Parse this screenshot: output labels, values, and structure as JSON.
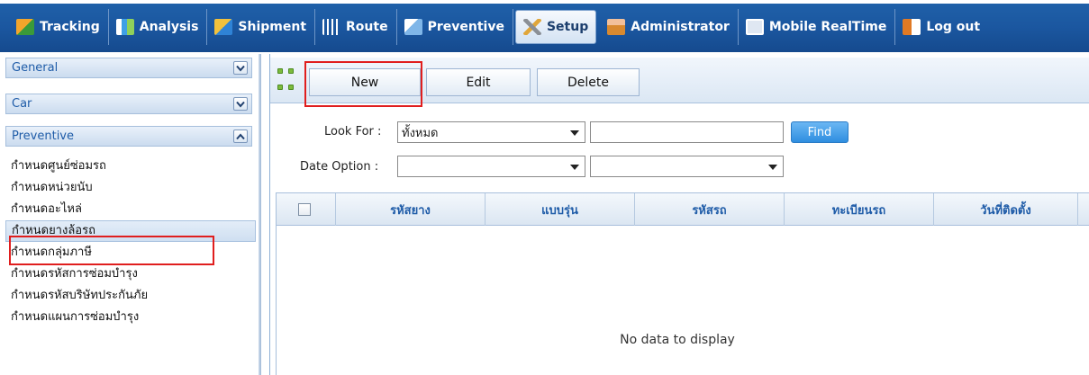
{
  "nav": {
    "items": [
      {
        "label": "Tracking",
        "icon": "tracking-icon"
      },
      {
        "label": "Analysis",
        "icon": "analysis-icon"
      },
      {
        "label": "Shipment",
        "icon": "shipment-icon"
      },
      {
        "label": "Route",
        "icon": "route-icon"
      },
      {
        "label": "Preventive",
        "icon": "preventive-icon"
      },
      {
        "label": "Setup",
        "icon": "setup-icon",
        "active": true
      },
      {
        "label": "Administrator",
        "icon": "administrator-icon"
      },
      {
        "label": "Mobile RealTime",
        "icon": "mobile-icon"
      },
      {
        "label": "Log out",
        "icon": "logout-icon"
      }
    ]
  },
  "sidebar": {
    "sections": [
      {
        "label": "General",
        "state": "collapsed"
      },
      {
        "label": "Car",
        "state": "collapsed"
      },
      {
        "label": "Preventive",
        "state": "expanded"
      }
    ],
    "items": [
      {
        "label": "กำหนดศูนย์ซ่อมรถ"
      },
      {
        "label": "กำหนดหน่วยนับ"
      },
      {
        "label": "กำหนดอะไหล่"
      },
      {
        "label": "กำหนดยางล้อรถ",
        "selected": true
      },
      {
        "label": "กำหนดกลุ่มภาษี"
      },
      {
        "label": "กำหนดรหัสการซ่อมบำรุง"
      },
      {
        "label": "กำหนดรหัสบริษัทประกันภัย"
      },
      {
        "label": "กำหนดแผนการซ่อมบำรุง"
      }
    ]
  },
  "toolbar": {
    "new_label": "New",
    "edit_label": "Edit",
    "delete_label": "Delete"
  },
  "filters": {
    "look_for_label": "Look For :",
    "look_for_value": "ทั้งหมด",
    "search_value": "",
    "find_label": "Find",
    "date_option_label": "Date Option :",
    "date_option_value": "",
    "date_option2_value": ""
  },
  "grid": {
    "columns": [
      "รหัสยาง",
      "แบบรุ่น",
      "รหัสรถ",
      "ทะเบียนรถ",
      "วันที่ติดตั้ง"
    ],
    "rows": [],
    "empty_text": "No data to display"
  },
  "colors": {
    "nav_bg": "#1b57a0",
    "accent": "#1f5ca8",
    "highlight": "#e01e1e",
    "find_button": "#2f8ee0"
  }
}
